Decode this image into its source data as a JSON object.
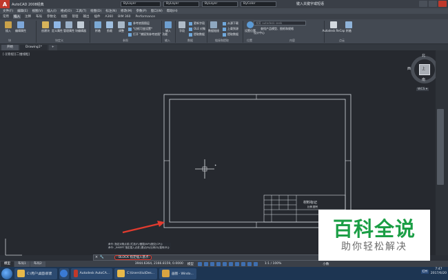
{
  "quick_access": {
    "app_letter": "A",
    "bar_text": "AutoCAD 2008经典",
    "layer_1": "ByLayer",
    "layer_2": "ByLayer",
    "layer_3": "ByLayer",
    "layer_4": "ByColor",
    "window_title": "键入关键字或短语"
  },
  "menubar": [
    "文件(F)",
    "编辑(E)",
    "视图(V)",
    "插入(I)",
    "格式(O)",
    "工具(T)",
    "绘图(D)",
    "标注(N)",
    "修改(M)",
    "参数(P)",
    "窗口(W)",
    "帮助(H)"
  ],
  "ribbon_tabs": [
    {
      "label": "常用",
      "active": false
    },
    {
      "label": "插入",
      "active": true
    },
    {
      "label": "注释",
      "active": false
    },
    {
      "label": "布局",
      "active": false
    },
    {
      "label": "参数化",
      "active": false
    },
    {
      "label": "视图",
      "active": false
    },
    {
      "label": "管理",
      "active": false
    },
    {
      "label": "输出",
      "active": false
    },
    {
      "label": "插件",
      "active": false
    },
    {
      "label": "A360",
      "active": false
    },
    {
      "label": "BIM 360",
      "active": false
    },
    {
      "label": "Performance",
      "active": false
    }
  ],
  "ribbon": {
    "insert": "插入",
    "edit_attr": "编辑属性",
    "create_block": "创建块",
    "define_attr": "定义属性",
    "manage_attr": "管理属性",
    "block_editor": "块编辑器",
    "attach": "附着",
    "clip": "剪裁",
    "adjust": "调整",
    "underlay_layers": "参考底图图层",
    "frames": "*边框可变设置*",
    "snap_ref": "打开 \"捕捉到参考底图\" 功能",
    "import": "输入",
    "field": "字段",
    "update_field": "更新字段",
    "ole": "OLE 对象",
    "extract_data": "提取数据",
    "data_link": "数据链接",
    "download": "从源下载",
    "upload": "上载到源",
    "set_location": "设置位置",
    "design_center": "设计中心",
    "search_placeholder": "搜索 autodesk seek",
    "find_models": "查找产品模型、图纸和规格",
    "autodesk_recap": "Autodesk ReCap",
    "attach2": "附着",
    "panel_block": "块",
    "panel_block_def": "块定义",
    "panel_reference": "参照",
    "panel_import": "输入",
    "panel_data": "数据",
    "panel_link": "链接和提取",
    "panel_location": "位置",
    "panel_content": "内容",
    "panel_cloud": "点云"
  },
  "doc_tabs": [
    {
      "label": "开始",
      "active": false
    },
    {
      "label": "Drawing1*",
      "active": true
    },
    {
      "label": "+",
      "active": false
    }
  ],
  "viewport": {
    "label": "[-][俯视][二维线框]",
    "compass_n": "北",
    "compass_s": "南",
    "compass_w": "西",
    "compass_e": "东",
    "compass_face": "上",
    "wcs": "WCS ▾"
  },
  "titleblock": {
    "title": "材料标记",
    "mark": "比例 图号"
  },
  "command": {
    "history_1": "命令: 指定对角点或 [栏选(F)/圈围(WP)/圈交(CP)]:",
    "history_2": "命令: _INSERT 指定插入点或 [基点(B)/比例(S)/旋转(R)]:",
    "prompt": "- BLOCK 指定插入基点:",
    "close": "×",
    "settings": "🔧"
  },
  "status": {
    "tab_model": "模型",
    "tab_layout1": "布局1",
    "tab_layout2": "布局2",
    "coords": "3944.6364, 2166.8159, 0.0000",
    "model_label": "模型",
    "scale": "1:1 / 100%",
    "small_label": "小数"
  },
  "taskbar": {
    "item_1": "C:\\用户\\桌面\\新建",
    "item_2": "Autodesk AutoCA...",
    "item_3": "C:\\Users\\liu\\Des...",
    "item_4": "画图 - Windo...",
    "lang": "CH",
    "time": "7:47",
    "date": "2017/6/20"
  },
  "watermark": {
    "main": "百科全说",
    "sub": "助你轻松解决"
  },
  "colors": {
    "accent_red": "#e23b2f",
    "watermark_green": "#1b9e45"
  }
}
